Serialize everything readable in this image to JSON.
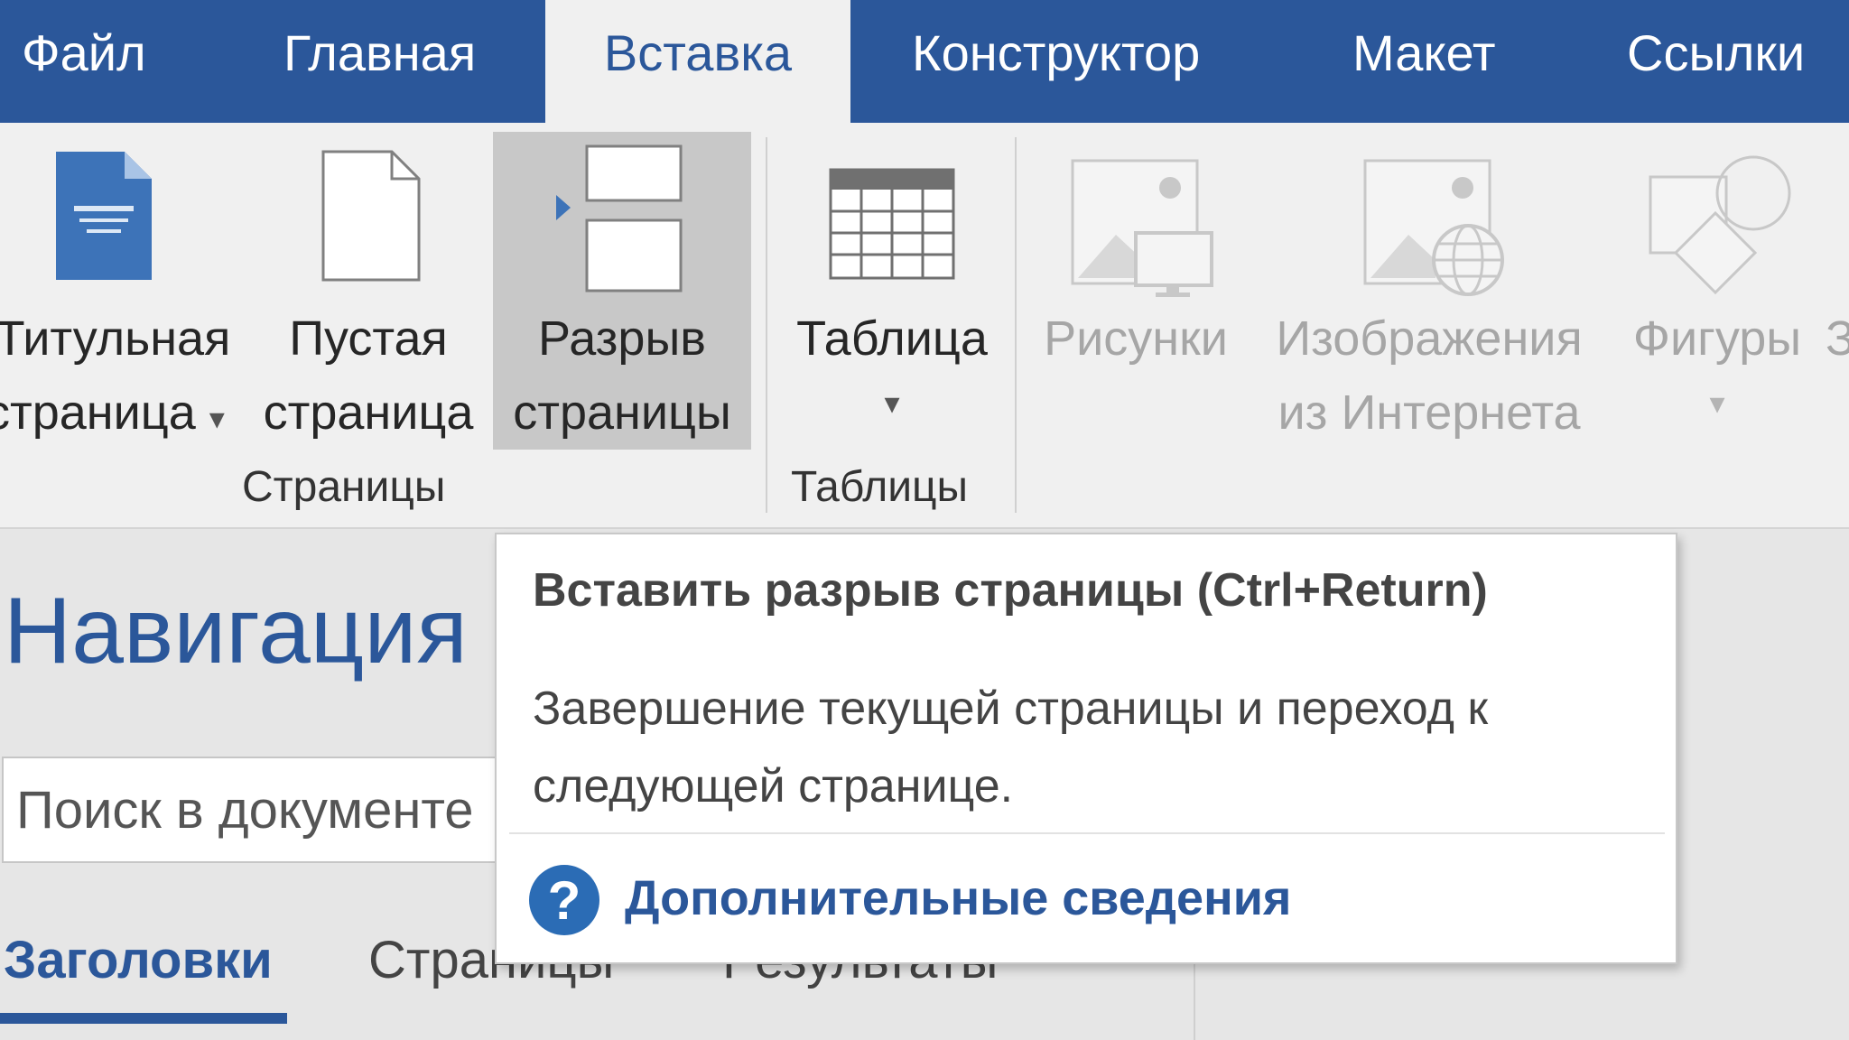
{
  "tabs": [
    {
      "label": "Файл"
    },
    {
      "label": "Главная"
    },
    {
      "label": "Вставка"
    },
    {
      "label": "Конструктор"
    },
    {
      "label": "Макет"
    },
    {
      "label": "Ссылки"
    }
  ],
  "ribbon": {
    "buttons": {
      "cover_page": {
        "line1": "Титульная",
        "line2": "страница",
        "icon": "cover-page-icon"
      },
      "blank_page": {
        "line1": "Пустая",
        "line2": "страница",
        "icon": "blank-page-icon"
      },
      "page_break": {
        "line1": "Разрыв",
        "line2": "страницы",
        "icon": "page-break-icon"
      },
      "table": {
        "line1": "Таблица",
        "icon": "table-icon"
      },
      "pictures": {
        "line1": "Рисунки",
        "icon": "pictures-icon"
      },
      "online_pictures": {
        "line1": "Изображения",
        "line2": "из Интернета",
        "icon": "online-pictures-icon"
      },
      "shapes": {
        "line1": "Фигуры",
        "icon": "shapes-icon"
      },
      "next_partial": {
        "line1": "З"
      }
    },
    "groups": {
      "pages": "Страницы",
      "tables": "Таблицы"
    }
  },
  "nav_pane": {
    "title": "Навигация",
    "search_placeholder": "Поиск в документе",
    "tabs": [
      {
        "label": "Заголовки"
      },
      {
        "label": "Страницы"
      },
      {
        "label": "Результаты"
      }
    ]
  },
  "tooltip": {
    "title": "Вставить разрыв страницы (Ctrl+Return)",
    "description": "Завершение текущей страницы и переход к следующей странице.",
    "help_icon_glyph": "?",
    "help_link": "Дополнительные сведения"
  },
  "colors": {
    "accent": "#2b579a",
    "ribbon_bg": "#f0f0f0",
    "hover_bg": "#c8c8c8",
    "disabled_text": "#a6a6a6"
  }
}
